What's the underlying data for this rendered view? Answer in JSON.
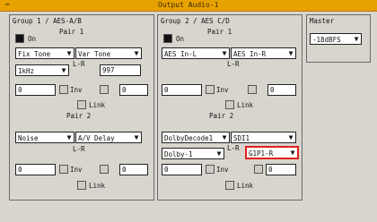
{
  "title": "Output Audio-1",
  "group1": {
    "title": "Group 1 / AES-A/B",
    "on_label": "On",
    "pair1_title": "Pair 1",
    "pair1": {
      "left_type": "Fix Tone",
      "right_type": "Var Tone",
      "lr": "L-R",
      "freq": "1kHz",
      "value": "997",
      "left_level": "0",
      "right_level": "0",
      "inv": "Inv",
      "link": "Link"
    },
    "pair2_title": "Pair 2",
    "pair2": {
      "left_type": "Noise",
      "right_type": "A/V Delay",
      "lr": "L-R",
      "left_level": "0",
      "right_level": "0",
      "inv": "Inv",
      "link": "Link"
    }
  },
  "group2": {
    "title": "Group 2 / AES C/D",
    "on_label": "On",
    "pair1_title": "Pair 1",
    "pair1": {
      "left_type": "AES In-L",
      "right_type": "AES In-R",
      "lr": "L-R",
      "left_level": "0",
      "right_level": "0",
      "inv": "Inv",
      "link": "Link"
    },
    "pair2_title": "Pair 2",
    "pair2": {
      "left_type": "DolbyDecode1",
      "right_type": "SDI1",
      "lr": "L-R",
      "dolby": "Dolby-1",
      "channel": "G1P1-R",
      "left_level": "0",
      "right_level": "0",
      "inv": "Inv",
      "link": "Link"
    }
  },
  "master": {
    "title": "Master",
    "level": "-18dBFS"
  },
  "colors": {
    "titlebar": "#e8a200",
    "highlight": "#e02020"
  }
}
